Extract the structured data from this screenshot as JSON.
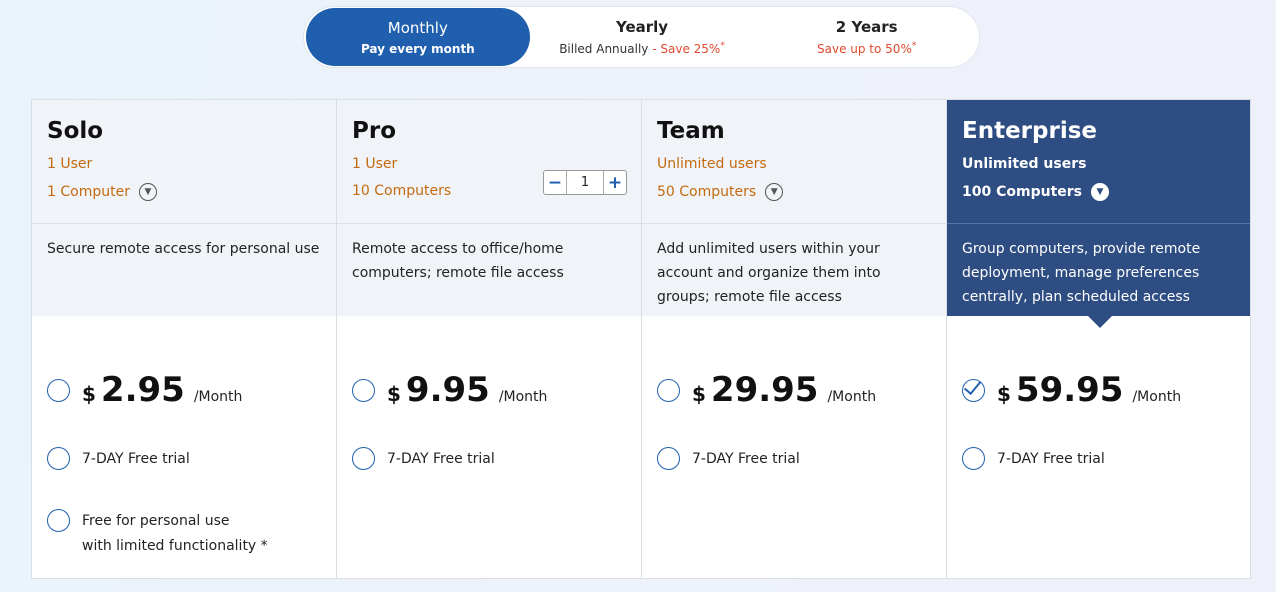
{
  "billing": {
    "options": [
      {
        "title": "Monthly",
        "subtitle": "Pay every month"
      },
      {
        "title": "Yearly",
        "subtitle": "Billed Annually",
        "save": "Save 25%",
        "mark": "*"
      },
      {
        "title": "2 Years",
        "save": "Save up to 50%",
        "mark": "*"
      }
    ],
    "selected": "Monthly"
  },
  "colors": {
    "accent": "#1f5fae",
    "highlight": "#2e4d82",
    "orange": "#c46a10",
    "save_red": "#e04a2f"
  },
  "plans": [
    {
      "name": "Solo",
      "users": "1 User",
      "computers": "1 Computer",
      "description": "Secure remote access for personal use",
      "currency": "$",
      "price": "2.95",
      "period": "/Month",
      "trial": "7-DAY Free trial",
      "free_option": "Free for personal use\nwith limited functionality *"
    },
    {
      "name": "Pro",
      "users": "1 User",
      "computers": "10 Computers",
      "stepper_value": "1",
      "description": "Remote access to office/home computers; remote file access",
      "currency": "$",
      "price": "9.95",
      "period": "/Month",
      "trial": "7-DAY Free trial"
    },
    {
      "name": "Team",
      "users": "Unlimited users",
      "computers": "50 Computers",
      "description": "Add unlimited users within your account and organize them into groups; remote file access",
      "currency": "$",
      "price": "29.95",
      "period": "/Month",
      "trial": "7-DAY Free trial"
    },
    {
      "name": "Enterprise",
      "users": "Unlimited users",
      "computers": "100 Computers",
      "description": "Group computers, provide remote deployment, manage preferences centrally, plan scheduled access",
      "currency": "$",
      "price": "59.95",
      "period": "/Month",
      "trial": "7-DAY Free trial",
      "selected": true
    }
  ]
}
